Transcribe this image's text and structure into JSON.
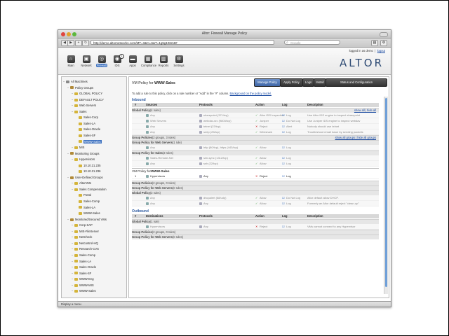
{
  "window": {
    "title": "Altor: Firewall Manage Policy"
  },
  "browser": {
    "url": "http://demo.altornetworks.com/MT=3&m=6&T=1g5g106m8#",
    "search_placeholder": "Google",
    "back": "◀",
    "forward": "▶",
    "add": "+",
    "reload": "↻"
  },
  "header": {
    "logged_in_as": "logged in as",
    "user": "demo",
    "logout": "logout",
    "logo": "ALTOR",
    "tabs": [
      {
        "label": "Main",
        "icon": "home-icon"
      },
      {
        "label": "Network",
        "icon": "network-icon"
      },
      {
        "label": "Firewall",
        "icon": "firewall-icon"
      },
      {
        "label": "IDS",
        "icon": "ids-icon",
        "badge": "1"
      },
      {
        "label": "Apps",
        "icon": "apps-icon"
      },
      {
        "label": "Compliance",
        "icon": "compliance-icon"
      },
      {
        "label": "Reports",
        "icon": "reports-icon"
      },
      {
        "label": "Settings",
        "icon": "settings-icon"
      }
    ]
  },
  "sidebar": {
    "items": [
      {
        "label": "All Machines",
        "level": 0
      },
      {
        "label": "Policy Groups",
        "level": 1
      },
      {
        "label": "GLOBAL POLICY",
        "level": 2
      },
      {
        "label": "DEFAULT POLICY",
        "level": 2
      },
      {
        "label": "Web Servers",
        "level": 2
      },
      {
        "label": "Sales",
        "level": 2
      },
      {
        "label": "Sales-Corp",
        "level": 3
      },
      {
        "label": "Sales-LA",
        "level": 3
      },
      {
        "label": "Sales-Oracle",
        "level": 3
      },
      {
        "label": "Sales-SF",
        "level": 3
      },
      {
        "label": "WWW-Sales",
        "level": 3,
        "selected": true
      },
      {
        "label": "MIS",
        "level": 2
      },
      {
        "label": "Monitoring Groups",
        "level": 1
      },
      {
        "label": "Hypervisors",
        "level": 2
      },
      {
        "label": "10.10.21.235",
        "level": 3
      },
      {
        "label": "10.10.21.236",
        "level": 3
      },
      {
        "label": "User-Defined Groups",
        "level": 1
      },
      {
        "label": "AltorVMs",
        "level": 2
      },
      {
        "label": "Sales Compensation",
        "level": 2
      },
      {
        "label": "Portal",
        "level": 3
      },
      {
        "label": "Sales-Comp",
        "level": 3
      },
      {
        "label": "Sales-LA",
        "level": 3
      },
      {
        "label": "WWW-Sales",
        "level": 3
      },
      {
        "label": "Monitored/Secured VMs",
        "level": 1
      },
      {
        "label": "Corp-SAP",
        "level": 2
      },
      {
        "label": "MIS-FileServer",
        "level": 2
      },
      {
        "label": "NetCheck",
        "level": 2
      },
      {
        "label": "Netcontrol-HQ",
        "level": 2
      },
      {
        "label": "Research-CVS",
        "level": 2
      },
      {
        "label": "Sales-Comp",
        "level": 2
      },
      {
        "label": "Sales-LA",
        "level": 2
      },
      {
        "label": "Sales-Oracle",
        "level": 2
      },
      {
        "label": "Sales-SF",
        "level": 2
      },
      {
        "label": "WWW-Eng",
        "level": 2
      },
      {
        "label": "WWW-MIS",
        "level": 2
      },
      {
        "label": "WWW-Sales",
        "level": 2
      }
    ]
  },
  "main": {
    "title_prefix": "VM Policy for",
    "title_target": "WWW-Sales",
    "buttons": [
      "Manage Policy",
      "Apply Policy",
      "Logs",
      "Install",
      "Status and Configuration"
    ],
    "hint": "To add a rule to this policy, click on a rule number or \"Add\" in the \"#\" column.",
    "hint_link": "Background on the policy model.",
    "inbound": {
      "label": "Inbound",
      "headers": [
        "#",
        "Sources",
        "Protocols",
        "Action",
        "Log",
        "Description"
      ],
      "global_policy": {
        "label": "Global Policy",
        "count": "(4 rules)",
        "links": "show all | hide all"
      },
      "global_rows": [
        {
          "src": "Any",
          "proto": "sharepoint (371/tcp)",
          "action": "Altor IDS Inspection",
          "log": "Log",
          "desc": "Use Altor IDS engine to inspect sharepoint"
        },
        {
          "src": "Web Servers",
          "proto": "webdav-src (9800/tcp)",
          "action": "Juniper",
          "log": "Do Not Log",
          "desc": "Use Juniper IDS engine to inspect webdav"
        },
        {
          "src": "Any",
          "proto": "telnet (23/tcp)",
          "action": "Reject",
          "log": "Alert",
          "desc": "Nobody should use telnet"
        },
        {
          "src": "Any",
          "proto": "smtp (25/tcp)",
          "action": "Wireshark",
          "log": "Log",
          "desc": "Troubleshoot email issue by sending packets"
        }
      ],
      "group_policies": {
        "label": "Group Policies",
        "count": "(2 groups, 3 rules)",
        "links": "show all groups | hide all groups"
      },
      "web_servers_group": {
        "label": "Group Policy for Web Servers",
        "count": "(1 rule)"
      },
      "web_rows": [
        {
          "src": "Any",
          "proto": "http (80/tcp), https (443/tcp)",
          "action": "Allow",
          "log": "Log",
          "desc": ""
        }
      ],
      "sales_group": {
        "label": "Group Policy for Sales",
        "count": "(2 rules)"
      },
      "sales_rows": [
        {
          "src": "Sales-Remote-Net",
          "proto": "sim-sync (1312/tcp)",
          "action": "Allow",
          "log": "Log",
          "desc": ""
        },
        {
          "src": "Any",
          "proto": "ssh (22/tcp)",
          "action": "Allow",
          "log": "Log",
          "desc": ""
        }
      ],
      "vm_policy": {
        "label_prefix": "VM Policy for",
        "label_target": "WWW-Sales"
      },
      "vm_rows": [
        {
          "num": "1",
          "src": "Hypervisors",
          "proto": "Any",
          "action": "Reject",
          "log": "Log",
          "desc": ""
        }
      ],
      "group_policies2": {
        "label": "Group Policies",
        "count": "(2 groups, 0 rules)"
      },
      "web_servers_group2": {
        "label": "Group Policy for Web Servers",
        "count": "(0 rules)"
      },
      "global_policy2": {
        "label": "Global Policy",
        "count": "(2 rules)"
      },
      "global2_rows": [
        {
          "src": "Any",
          "proto": "dhcpalert (68/udp)",
          "action": "Allow",
          "log": "Do Not Log",
          "desc": "Altor default allow DHCP."
        },
        {
          "src": "Any",
          "proto": "Any",
          "action": "Allow",
          "log": "Log",
          "desc": "Formerly an Altor default reject \"clean-up\""
        }
      ]
    },
    "outbound": {
      "label": "Outbound",
      "headers": [
        "#",
        "Destinations",
        "Protocols",
        "Action",
        "Log",
        "Description"
      ],
      "global_policy": {
        "label": "Global Policy",
        "count": "(1 rule)"
      },
      "rows": [
        {
          "src": "Hypervisors",
          "proto": "Any",
          "action": "Reject",
          "log": "Log",
          "desc": "VMs cannot connect to any Hypervisor"
        }
      ],
      "group_policies": {
        "label": "Group Policies",
        "count": "(2 groups, 0 rules)"
      },
      "web_servers_group": {
        "label": "Group Policy for Web Servers",
        "count": "(0 rules)"
      }
    }
  },
  "statusbar": {
    "text": "Display a menu"
  },
  "colors": {
    "accent": "#3a6fbf",
    "brand": "#2d4a73",
    "link": "#1a4aa0",
    "allow": "#3c9a3c",
    "reject": "#cc2222"
  }
}
